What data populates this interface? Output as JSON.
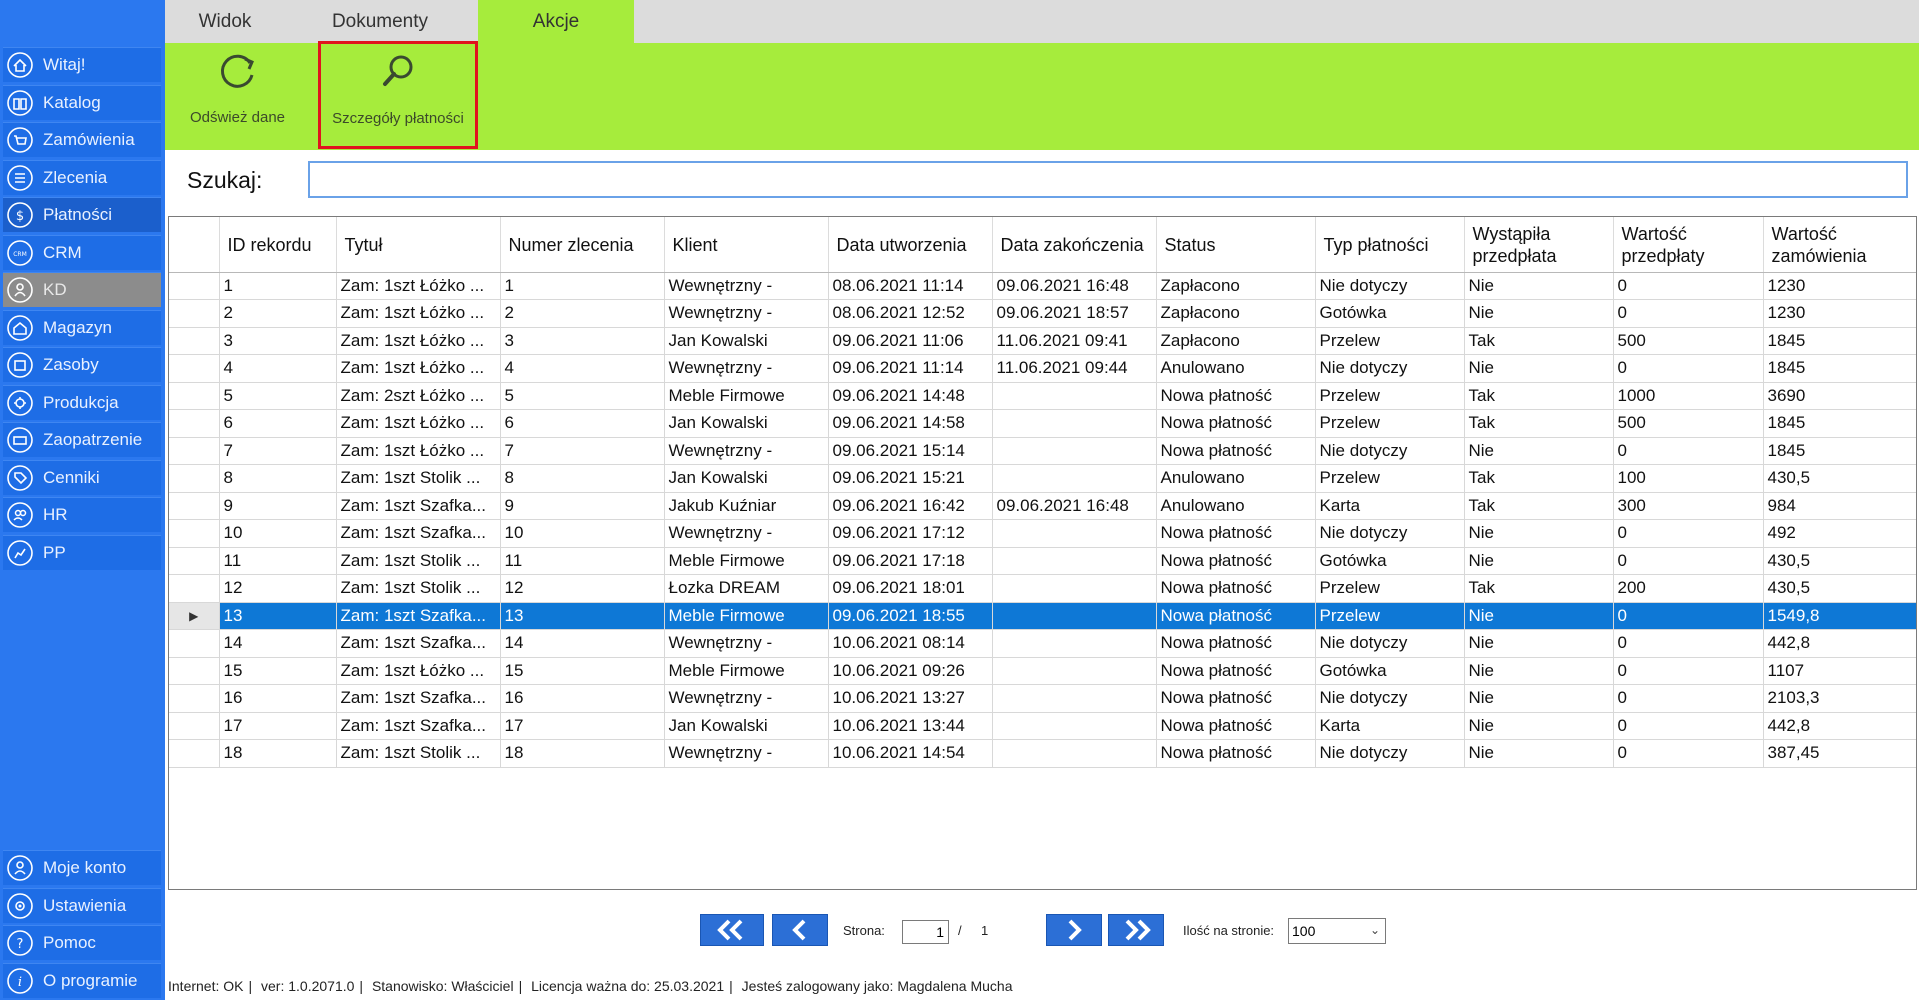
{
  "sidebar": {
    "items": [
      {
        "label": "Witaj!",
        "icon": "home-icon"
      },
      {
        "label": "Katalog",
        "icon": "book-icon"
      },
      {
        "label": "Zamówienia",
        "icon": "cart-icon"
      },
      {
        "label": "Zlecenia",
        "icon": "list-icon"
      },
      {
        "label": "Płatności",
        "icon": "dollar-icon"
      },
      {
        "label": "CRM",
        "icon": "crm-icon"
      },
      {
        "label": "KD",
        "icon": "lock-icon"
      },
      {
        "label": "Magazyn",
        "icon": "warehouse-icon"
      },
      {
        "label": "Zasoby",
        "icon": "box-icon"
      },
      {
        "label": "Produkcja",
        "icon": "gear-icon"
      },
      {
        "label": "Zaopatrzenie",
        "icon": "truck-icon"
      },
      {
        "label": "Cenniki",
        "icon": "tag-icon"
      },
      {
        "label": "HR",
        "icon": "people-icon"
      },
      {
        "label": "PP",
        "icon": "chart-icon"
      }
    ],
    "bottom_items": [
      {
        "label": "Moje konto",
        "icon": "user-icon"
      },
      {
        "label": "Ustawienia",
        "icon": "settings-icon"
      },
      {
        "label": "Pomoc",
        "icon": "help-icon"
      },
      {
        "label": "O programie",
        "icon": "info-icon"
      }
    ],
    "active": "Płatności"
  },
  "tabs": [
    {
      "label": "Widok"
    },
    {
      "label": "Dokumenty"
    },
    {
      "label": "Akcje"
    }
  ],
  "ribbon": {
    "refresh_label": "Odśwież dane",
    "details_label": "Szczegóły płatności"
  },
  "search": {
    "label": "Szukaj:",
    "value": ""
  },
  "table": {
    "columns": [
      "ID rekordu",
      "Tytuł",
      "Numer zlecenia",
      "Klient",
      "Data utworzenia",
      "Data zakończenia",
      "Status",
      "Typ płatności",
      "Wystąpiła przedpłata",
      "Wartość przedpłaty",
      "Wartość zamówienia"
    ],
    "rows": [
      [
        "1",
        "Zam: 1szt Łóżko ...",
        "1",
        "Wewnętrzny -",
        "08.06.2021 11:14",
        "09.06.2021 16:48",
        "Zapłacono",
        "Nie dotyczy",
        "Nie",
        "0",
        "1230"
      ],
      [
        "2",
        "Zam: 1szt Łóżko ...",
        "2",
        "Wewnętrzny -",
        "08.06.2021 12:52",
        "09.06.2021 18:57",
        "Zapłacono",
        "Gotówka",
        "Nie",
        "0",
        "1230"
      ],
      [
        "3",
        "Zam: 1szt Łóżko ...",
        "3",
        "Jan Kowalski",
        "09.06.2021 11:06",
        "11.06.2021 09:41",
        "Zapłacono",
        "Przelew",
        "Tak",
        "500",
        "1845"
      ],
      [
        "4",
        "Zam: 1szt Łóżko ...",
        "4",
        "Wewnętrzny -",
        "09.06.2021 11:14",
        "11.06.2021 09:44",
        "Anulowano",
        "Nie dotyczy",
        "Nie",
        "0",
        "1845"
      ],
      [
        "5",
        "Zam: 2szt Łóżko ...",
        "5",
        "Meble Firmowe",
        "09.06.2021 14:48",
        "",
        "Nowa płatność",
        "Przelew",
        "Tak",
        "1000",
        "3690"
      ],
      [
        "6",
        "Zam: 1szt Łóżko ...",
        "6",
        "Jan Kowalski",
        "09.06.2021 14:58",
        "",
        "Nowa płatność",
        "Przelew",
        "Tak",
        "500",
        "1845"
      ],
      [
        "7",
        "Zam: 1szt Łóżko ...",
        "7",
        "Wewnętrzny -",
        "09.06.2021 15:14",
        "",
        "Nowa płatność",
        "Nie dotyczy",
        "Nie",
        "0",
        "1845"
      ],
      [
        "8",
        "Zam: 1szt Stolik ...",
        "8",
        "Jan Kowalski",
        "09.06.2021 15:21",
        "",
        "Anulowano",
        "Przelew",
        "Tak",
        "100",
        "430,5"
      ],
      [
        "9",
        "Zam: 1szt Szafka...",
        "9",
        "Jakub Kuźniar",
        "09.06.2021 16:42",
        "09.06.2021 16:48",
        "Anulowano",
        "Karta",
        "Tak",
        "300",
        "984"
      ],
      [
        "10",
        "Zam: 1szt Szafka...",
        "10",
        "Wewnętrzny -",
        "09.06.2021 17:12",
        "",
        "Nowa płatność",
        "Nie dotyczy",
        "Nie",
        "0",
        "492"
      ],
      [
        "11",
        "Zam: 1szt Stolik ...",
        "11",
        "Meble Firmowe",
        "09.06.2021 17:18",
        "",
        "Nowa płatność",
        "Gotówka",
        "Nie",
        "0",
        "430,5"
      ],
      [
        "12",
        "Zam: 1szt Stolik ...",
        "12",
        "Łozka DREAM",
        "09.06.2021 18:01",
        "",
        "Nowa płatność",
        "Przelew",
        "Tak",
        "200",
        "430,5"
      ],
      [
        "13",
        "Zam: 1szt Szafka...",
        "13",
        "Meble Firmowe",
        "09.06.2021 18:55",
        "",
        "Nowa płatność",
        "Przelew",
        "Nie",
        "0",
        "1549,8"
      ],
      [
        "14",
        "Zam: 1szt Szafka...",
        "14",
        "Wewnętrzny -",
        "10.06.2021 08:14",
        "",
        "Nowa płatność",
        "Nie dotyczy",
        "Nie",
        "0",
        "442,8"
      ],
      [
        "15",
        "Zam: 1szt Łóżko ...",
        "15",
        "Meble Firmowe",
        "10.06.2021 09:26",
        "",
        "Nowa płatność",
        "Gotówka",
        "Nie",
        "0",
        "1107"
      ],
      [
        "16",
        "Zam: 1szt Szafka...",
        "16",
        "Wewnętrzny -",
        "10.06.2021 13:27",
        "",
        "Nowa płatność",
        "Nie dotyczy",
        "Nie",
        "0",
        "2103,3"
      ],
      [
        "17",
        "Zam: 1szt Szafka...",
        "17",
        "Jan Kowalski",
        "10.06.2021 13:44",
        "",
        "Nowa płatność",
        "Karta",
        "Nie",
        "0",
        "442,8"
      ],
      [
        "18",
        "Zam: 1szt Stolik ...",
        "18",
        "Wewnętrzny -",
        "10.06.2021 14:54",
        "",
        "Nowa płatność",
        "Nie dotyczy",
        "Nie",
        "0",
        "387,45"
      ]
    ],
    "selected_row": 12
  },
  "pager": {
    "page_label": "Strona:",
    "page_value": "1",
    "separator": "/",
    "total_pages": "1",
    "per_page_label": "Ilość na stronie:",
    "per_page_value": "100"
  },
  "status": {
    "internet": "Internet: OK",
    "version": "ver: 1.0.2071.0",
    "position": "Stanowisko: Właściciel",
    "license": "Licencja ważna do: 25.03.2021",
    "user": "Jesteś zalogowany jako: Magdalena Mucha"
  },
  "colors": {
    "sidebar": "#2b78ef",
    "ribbon": "#a6ec3c",
    "selection": "#0e78d6",
    "highlight": "#e0141e"
  }
}
